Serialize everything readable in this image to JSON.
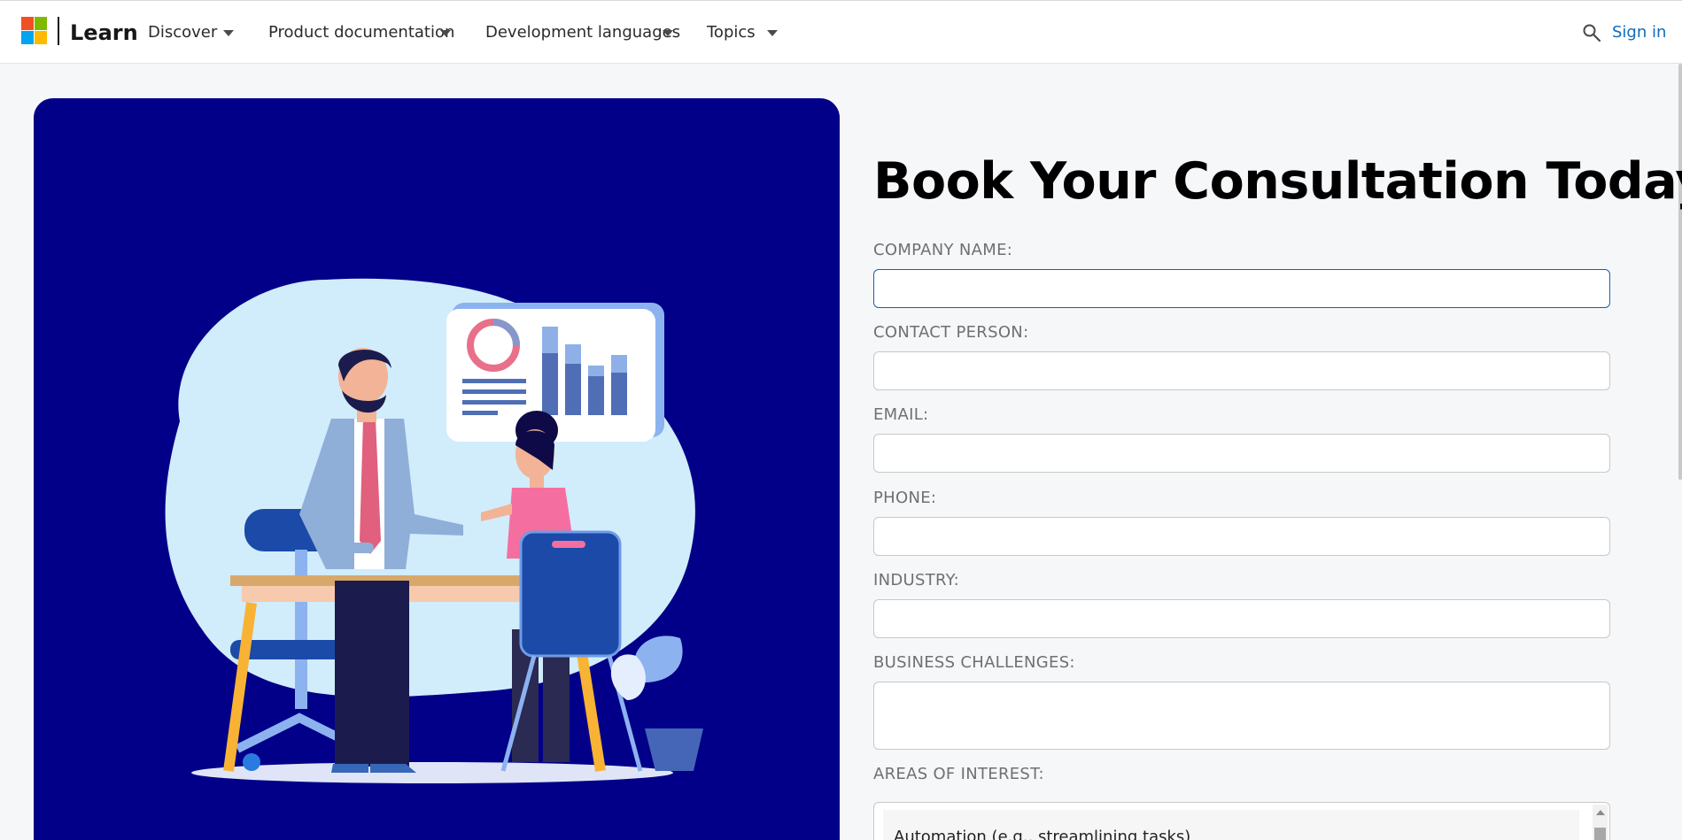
{
  "header": {
    "brand": "Learn",
    "nav": [
      {
        "label": "Discover"
      },
      {
        "label": "Product documentation"
      },
      {
        "label": "Development languages"
      },
      {
        "label": "Topics"
      }
    ],
    "sign_in": "Sign in",
    "colors": {
      "accent": "#0f6cbd",
      "hero_bg": "#020088"
    }
  },
  "form": {
    "title": "Book Your Consultation Today",
    "fields": [
      {
        "label": "COMPANY NAME:",
        "value": "",
        "state": "focused"
      },
      {
        "label": "CONTACT PERSON:",
        "value": ""
      },
      {
        "label": "EMAIL:",
        "value": ""
      },
      {
        "label": "PHONE:",
        "value": ""
      },
      {
        "label": "INDUSTRY:",
        "value": ""
      },
      {
        "label": "BUSINESS CHALLENGES:",
        "value": ""
      },
      {
        "label": "AREAS OF INTEREST:"
      }
    ],
    "areas_of_interest_options": [
      "Automation (e.g., streamlining tasks)"
    ]
  },
  "icons": [
    "microsoft-logo",
    "chevron-down-icon",
    "search-icon"
  ]
}
